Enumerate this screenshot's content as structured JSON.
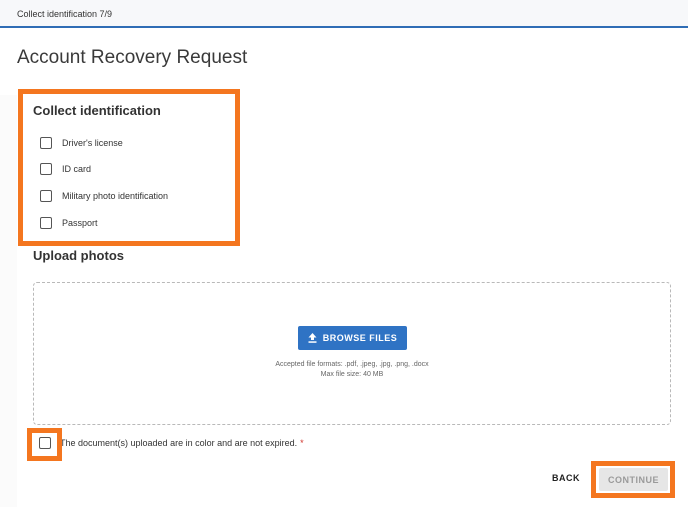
{
  "header": {
    "step_text": "Collect identification 7/9"
  },
  "page": {
    "title": "Account Recovery Request"
  },
  "collect": {
    "title": "Collect identification",
    "options": [
      {
        "label": "Driver's license",
        "checked": false
      },
      {
        "label": "ID card",
        "checked": false
      },
      {
        "label": "Military photo identification",
        "checked": false
      },
      {
        "label": "Passport",
        "checked": false
      }
    ]
  },
  "upload": {
    "title": "Upload photos",
    "browse_label": "BROWSE FILES",
    "browse_icon": "upload-icon",
    "formats_hint": "Accepted file formats: .pdf, .jpeg, .jpg, .png, .docx",
    "size_hint": "Max file size: 40 MB"
  },
  "confirm": {
    "label": "The document(s) uploaded are in color and are not expired.",
    "required_mark": "*",
    "checked": false
  },
  "actions": {
    "back_label": "BACK",
    "continue_label": "CONTINUE",
    "continue_enabled": false
  },
  "colors": {
    "accent": "#2f73c4",
    "highlight": "#f4761f",
    "required": "#d0342c"
  }
}
